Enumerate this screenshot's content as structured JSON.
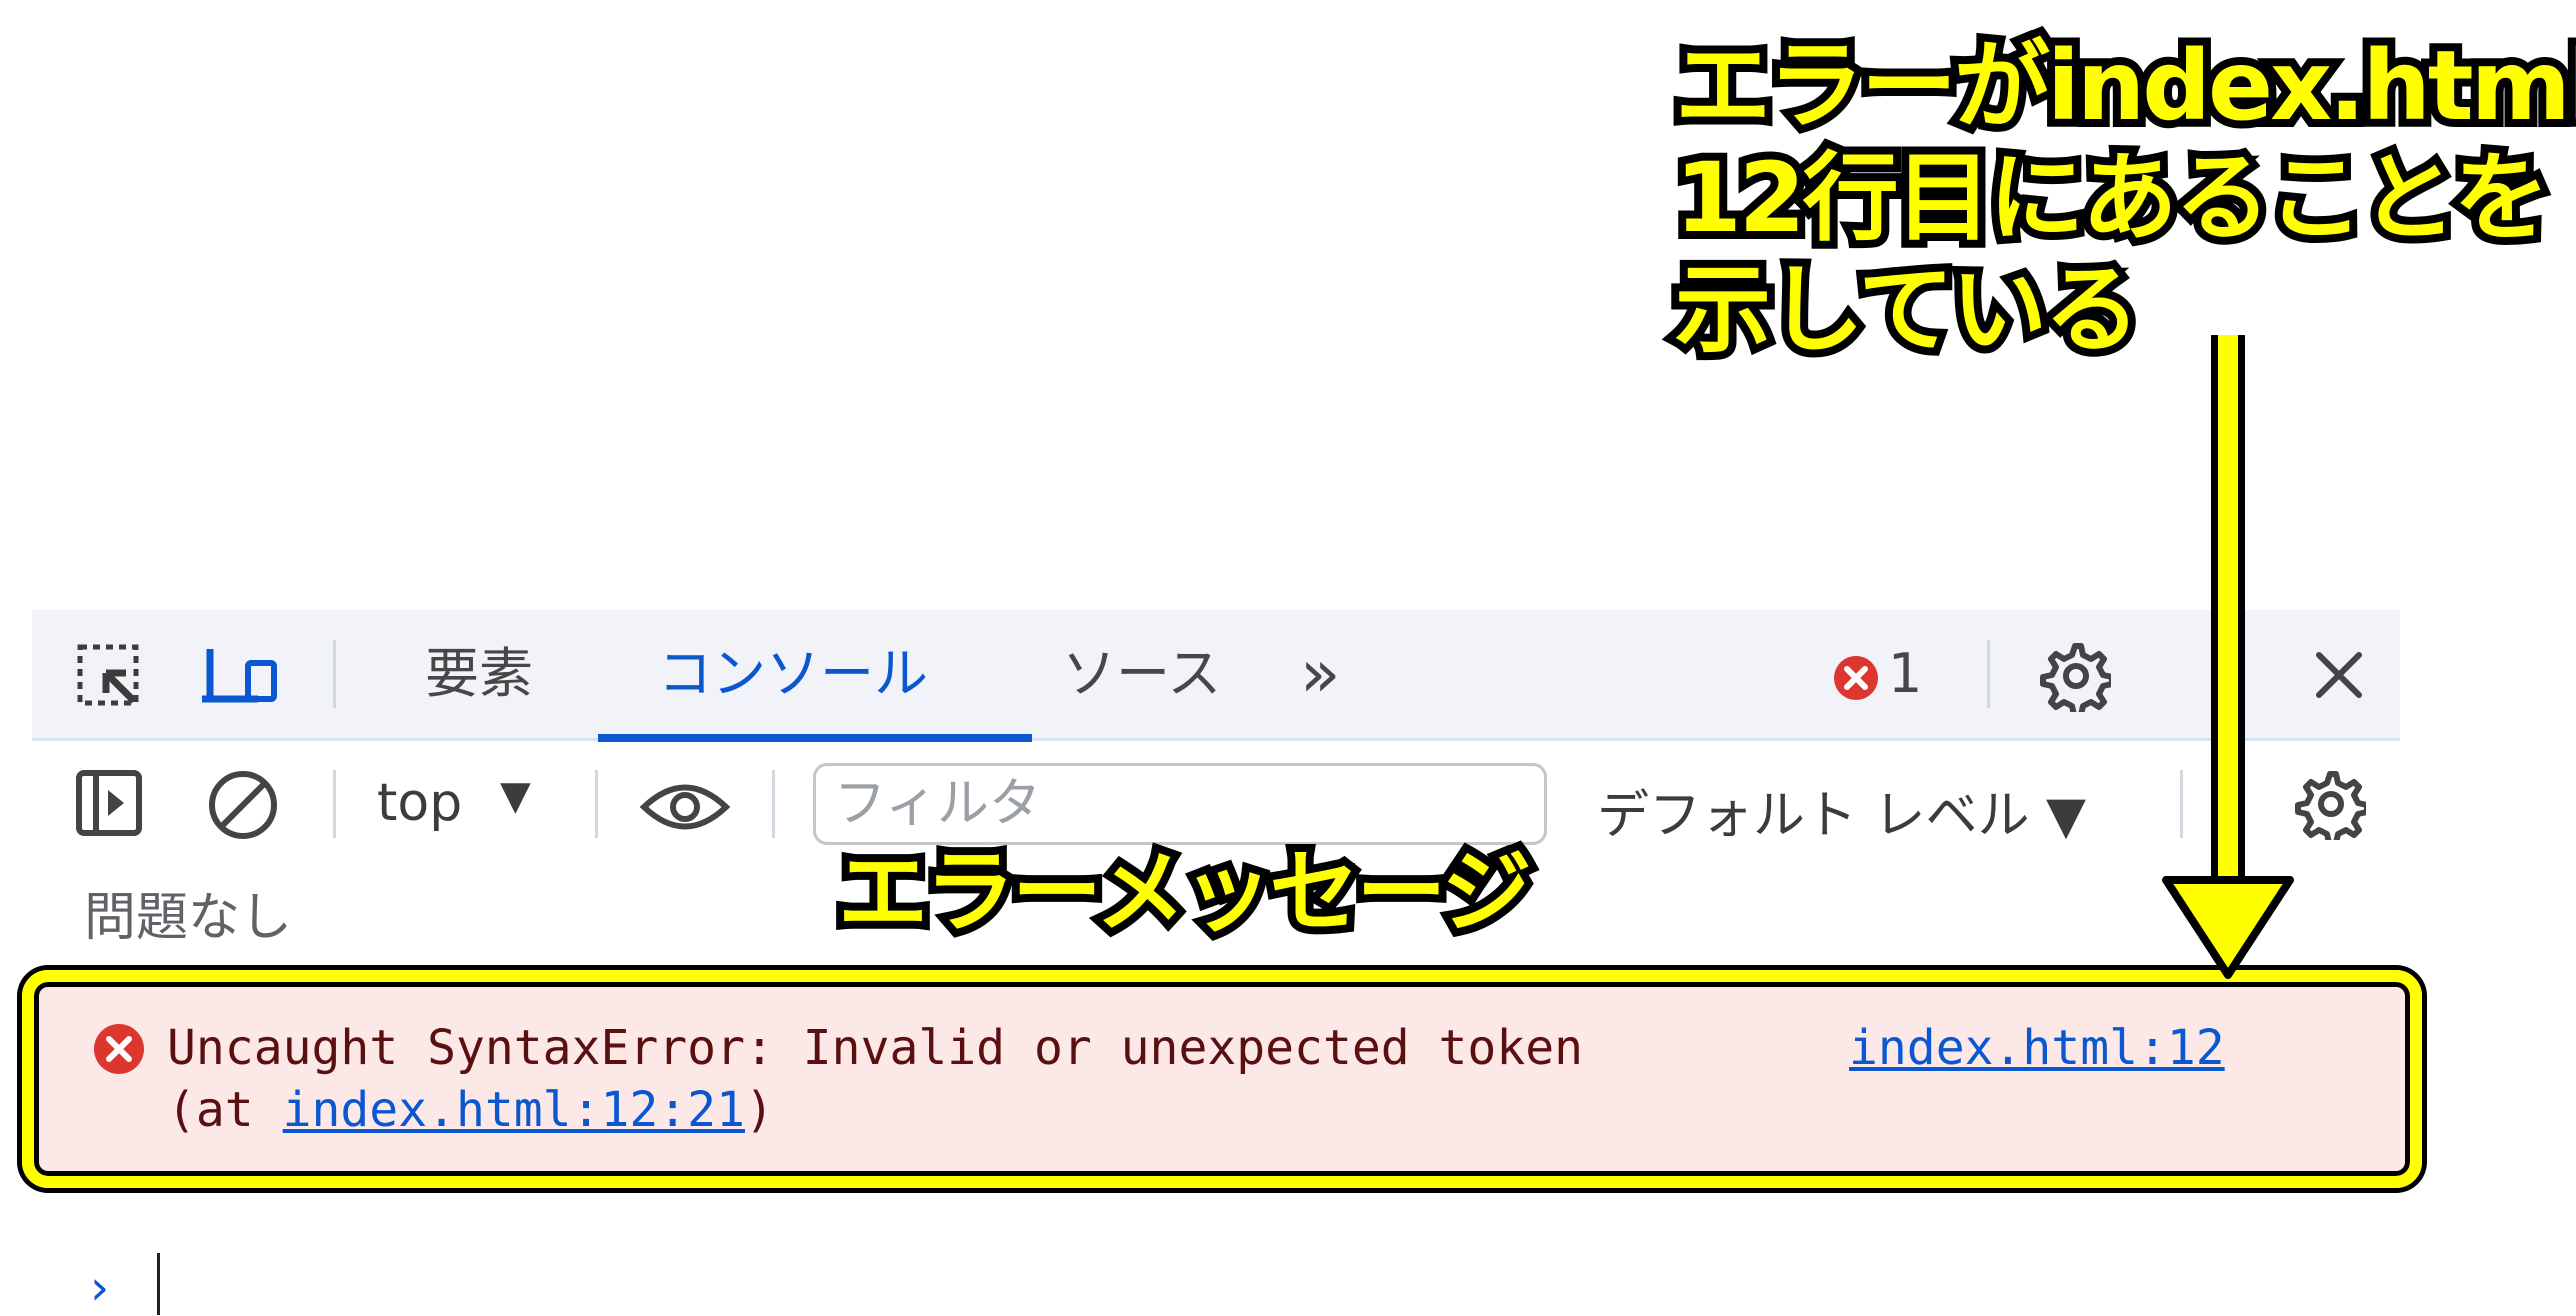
{
  "tabs": {
    "elements": "要素",
    "console": "コンソール",
    "sources": "ソース",
    "more": "»",
    "error_count": "1"
  },
  "toolbar": {
    "context": "top",
    "context_caret": "▼",
    "filter_placeholder": "フィルタ",
    "levels": "デフォルト レベル ▼"
  },
  "console": {
    "issues_label": "問題なし",
    "error_message": "Uncaught SyntaxError: Invalid or unexpected token",
    "error_source_link": "index.html:12",
    "error_at_prefix": "(at ",
    "error_at_link": "index.html:12:21",
    "error_at_suffix": ")",
    "prompt_symbol": "›"
  },
  "annotations": {
    "top_callout": [
      "エラーがindex.htmlの",
      "12行目にあることを",
      "示している"
    ],
    "message_callout": "エラーメッセージ"
  },
  "icons": {
    "inspect": "inspect-element-icon",
    "device": "device-toolbar-icon",
    "settings": "gear-icon",
    "more": "kebab-menu-icon",
    "close": "close-icon",
    "sidebar": "sidebar-toggle-icon",
    "clear": "clear-console-icon",
    "live_expression": "eye-icon"
  },
  "colors": {
    "accent": "#0b57d0",
    "error_bg": "#fce8e6",
    "error_icon": "#dc362e",
    "highlight": "#ffff00"
  }
}
